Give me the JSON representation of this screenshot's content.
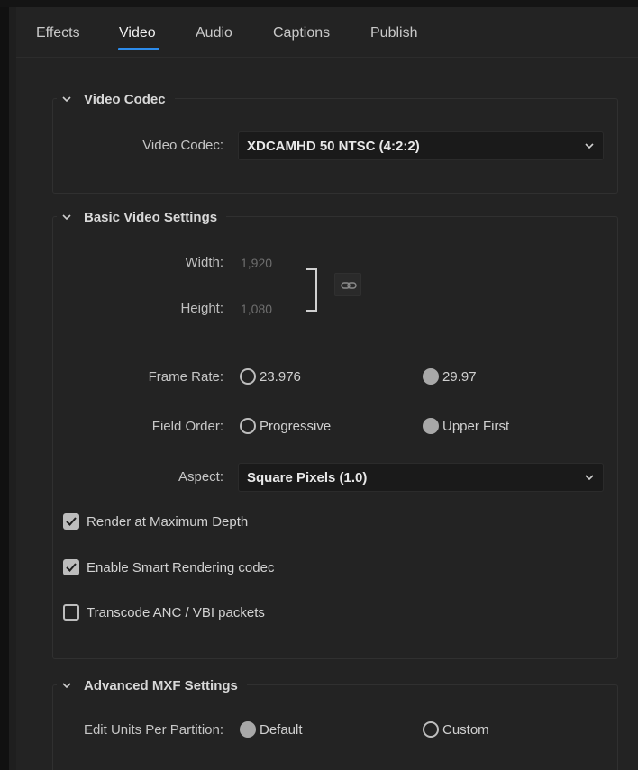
{
  "tabs": [
    {
      "label": "Effects",
      "active": false
    },
    {
      "label": "Video",
      "active": true
    },
    {
      "label": "Audio",
      "active": false
    },
    {
      "label": "Captions",
      "active": false
    },
    {
      "label": "Publish",
      "active": false
    }
  ],
  "video_codec_section": {
    "title": "Video Codec",
    "codec_label": "Video Codec:",
    "codec_value": "XDCAMHD 50 NTSC (4:2:2)"
  },
  "basic_section": {
    "title": "Basic Video Settings",
    "width_label": "Width:",
    "width_value": "1,920",
    "height_label": "Height:",
    "height_value": "1,080",
    "frame_rate_label": "Frame Rate:",
    "frame_rate_options": [
      {
        "label": "23.976",
        "selected": false
      },
      {
        "label": "29.97",
        "selected": true
      }
    ],
    "field_order_label": "Field Order:",
    "field_order_options": [
      {
        "label": "Progressive",
        "selected": false
      },
      {
        "label": "Upper First",
        "selected": true
      }
    ],
    "aspect_label": "Aspect:",
    "aspect_value": "Square Pixels (1.0)",
    "checkboxes": [
      {
        "label": "Render at Maximum Depth",
        "checked": true
      },
      {
        "label": "Enable Smart Rendering codec",
        "checked": true
      },
      {
        "label": "Transcode ANC / VBI packets",
        "checked": false
      }
    ]
  },
  "mxf_section": {
    "title": "Advanced MXF Settings",
    "edit_units_label": "Edit Units Per Partition:",
    "edit_units_options": [
      {
        "label": "Default",
        "selected": true
      },
      {
        "label": "Custom",
        "selected": false
      }
    ]
  },
  "icons": {
    "chevron": "chevron-down-icon",
    "link": "link-icon",
    "check": "checkmark-icon"
  },
  "colors": {
    "accent": "#2d8ceb",
    "panel_bg": "#232323",
    "field_bg": "#1a1a1a"
  }
}
